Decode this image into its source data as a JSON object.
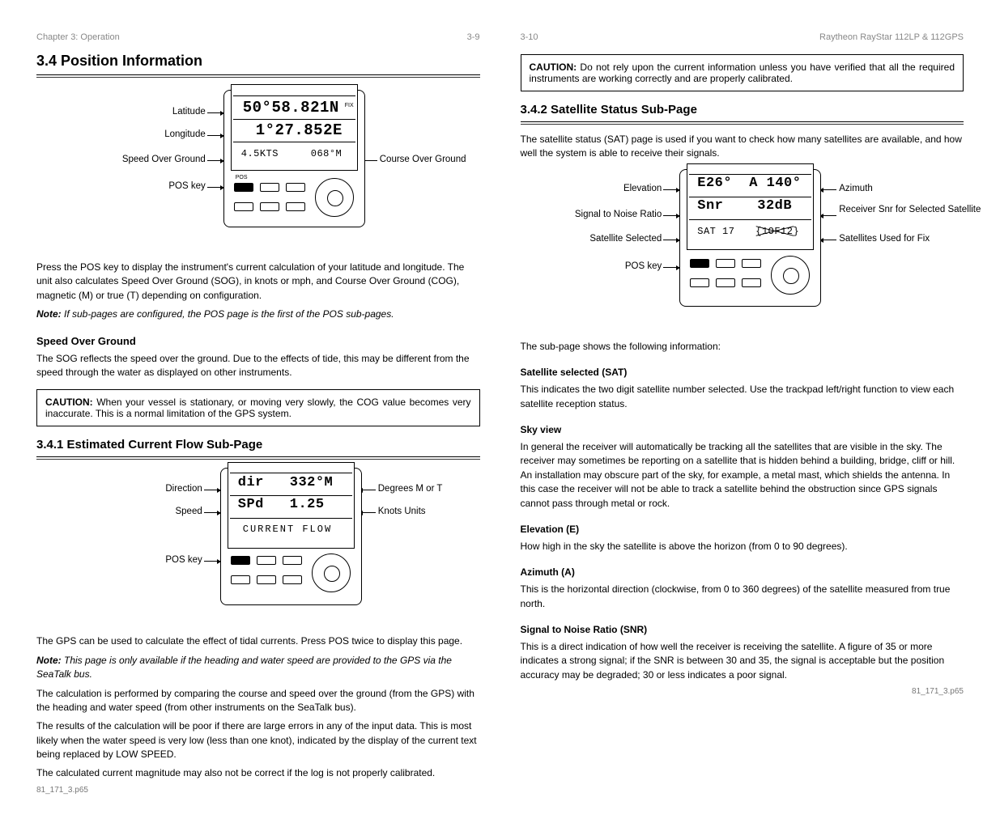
{
  "left": {
    "header": {
      "chapter": "Chapter 3: Operation",
      "page": "3-9"
    },
    "sec_title": "3.4 Position Information",
    "fig1": {
      "lbl_lat": "Latitude",
      "lbl_lon": "Longitude",
      "lbl_sog": "Speed Over Ground",
      "lbl_pos": "POS key",
      "lbl_cog": "Course Over Ground",
      "line1": "50°58.821N",
      "fix": "FIX",
      "line2": "1°27.852E",
      "line3a": "4.5KTS",
      "line3b": "068°M",
      "key_pos": "POS"
    },
    "p1": "Press the POS key to display the instrument's current calculation of your latitude and longitude. The unit also calculates Speed Over Ground (SOG), in knots or mph, and Course Over Ground (COG), magnetic (M) or true (T) depending on configuration.",
    "note_1a": "Note: ",
    "note_1b": "If sub-pages are configured, the POS page is the first of the POS sub-pages.",
    "sub1": "Speed Over Ground",
    "p2": "The SOG reflects the speed over the ground. Due to the effects of tide, this may be different from the speed through the water as displayed on other instruments.",
    "caution1_h": "CAUTION: ",
    "caution1": "When your vessel is stationary, or moving very slowly, the COG value becomes very inaccurate. This is a normal limitation of the GPS system.",
    "sec_title2": "3.4.1 Estimated Current Flow Sub-Page",
    "fig2": {
      "lbl_dir": "Direction",
      "lbl_spd": "Speed",
      "lbl_pos": "POS key",
      "lbl_degM": "Degrees M or T",
      "lbl_ku": "Knots Units",
      "line1a": "dir",
      "line1b": "332°M",
      "line2a": "SPd",
      "line2b": "1.25",
      "line3": "CURRENT  FLOW"
    },
    "p3": "The GPS can be used to calculate the effect of tidal currents. Press POS twice to display this page.",
    "note_2a": "Note: ",
    "note_2b": "This page is only available if the heading and water speed are provided to the GPS via the SeaTalk bus.",
    "p4": "The calculation is performed by comparing the course and speed over the ground (from the GPS) with the heading and water speed (from other instruments on the SeaTalk bus).",
    "p5": "The results of the calculation will be poor if there are large errors in any of the input data. This is most likely when the water speed is very low (less than one knot), indicated by the display of the current text being replaced by LOW SPEED.",
    "p6": "The calculated current magnitude may also not be correct if the log is not properly calibrated.",
    "footer": "81_171_3.p65"
  },
  "right": {
    "header": {
      "chapter": "Raytheon RayStar 112LP & 112GPS",
      "page": "3-10"
    },
    "caution_h": "CAUTION: ",
    "caution": "Do not rely upon the current information unless you have verified that all the required instruments are working correctly and are properly calibrated.",
    "sec_title": "3.4.2 Satellite Status Sub-Page",
    "p1": "The satellite status (SAT) page is used if you want to check how many satellites are available, and how well the system is able to receive their signals.",
    "fig3": {
      "lbl_el": "Elevation",
      "lbl_az": "Azimuth",
      "lbl_snr": "Signal to Noise Ratio",
      "lbl_sats": "Satellites Used for Fix",
      "lbl_sel": "Satellite Selected",
      "lbl_pos": "POS key",
      "lbl_snrval": "Receiver Snr for Selected Satellite",
      "line1a": "E26°",
      "line1b": "A 140°",
      "line2a": "Snr",
      "line2b": "32dB",
      "line3a": "SAT 17",
      "line3b": "{1OF12}"
    },
    "p2": "The sub-page shows the following information:",
    "sub1": "Satellite selected (SAT)",
    "p3": "This indicates the two digit satellite number selected. Use the trackpad left/right function to view each satellite reception status.",
    "sub2": "Sky view",
    "p4": "In general the receiver will automatically be tracking all the satellites that are visible in the sky. The receiver may sometimes be reporting on a satellite that is hidden behind a building, bridge, cliff or hill. An installation may obscure part of the sky, for example, a metal mast, which shields the antenna. In this case the receiver will not be able to track a satellite behind the obstruction since GPS signals cannot pass through metal or rock.",
    "sub3": "Elevation (E)",
    "p5": "How high in the sky the satellite is above the horizon (from 0 to 90 degrees).",
    "sub4": "Azimuth (A)",
    "p6": "This is the horizontal direction (clockwise, from 0 to 360 degrees) of the satellite measured from true north.",
    "sub5": "Signal to Noise Ratio (SNR)",
    "p7": "This is a direct indication of how well the receiver is receiving the satellite. A figure of 35 or more indicates a strong signal; if the SNR is between 30 and 35, the signal is acceptable but the position accuracy may be degraded; 30 or less indicates a poor signal.",
    "footer": "81_171_3.p65"
  }
}
